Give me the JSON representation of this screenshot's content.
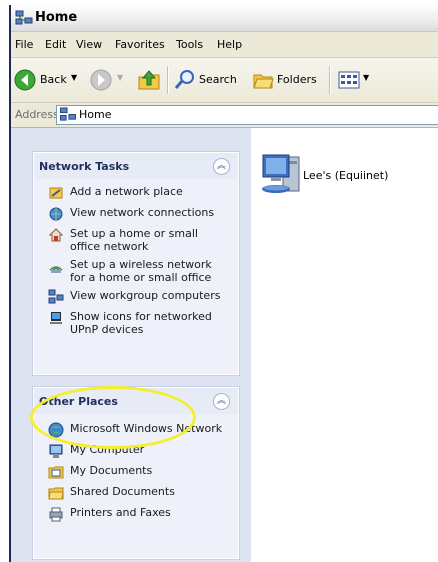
{
  "window": {
    "title": "Home"
  },
  "menu": [
    "File",
    "Edit",
    "View",
    "Favorites",
    "Tools",
    "Help"
  ],
  "toolbar": {
    "back": "Back",
    "search": "Search",
    "folders": "Folders"
  },
  "address": {
    "label": "Address",
    "value": "Home"
  },
  "network_tasks": {
    "title": "Network Tasks",
    "items": [
      {
        "label": "Add a network place",
        "icon": "add-network-place-icon"
      },
      {
        "label": "View network connections",
        "icon": "network-connections-icon"
      },
      {
        "label": "Set up a home or small office network",
        "icon": "home-network-setup-icon"
      },
      {
        "label": "Set up a wireless network for a home or small office",
        "icon": "wireless-setup-icon"
      },
      {
        "label": "View workgroup computers",
        "icon": "workgroup-icon"
      },
      {
        "label": "Show icons for networked UPnP devices",
        "icon": "upnp-icon"
      }
    ]
  },
  "other_places": {
    "title": "Other Places",
    "items": [
      {
        "label": "Microsoft Windows Network",
        "icon": "windows-network-icon"
      },
      {
        "label": "My Computer",
        "icon": "my-computer-icon"
      },
      {
        "label": "My Documents",
        "icon": "my-documents-icon"
      },
      {
        "label": "Shared Documents",
        "icon": "shared-documents-icon"
      },
      {
        "label": "Printers and Faxes",
        "icon": "printers-faxes-icon"
      }
    ]
  },
  "content": {
    "items": [
      {
        "label": "Lee's (Equiinet)",
        "icon": "network-computer-icon"
      }
    ]
  },
  "colors": {
    "highlight": "#f4ef2c",
    "taskpane": "#dde3f1"
  }
}
